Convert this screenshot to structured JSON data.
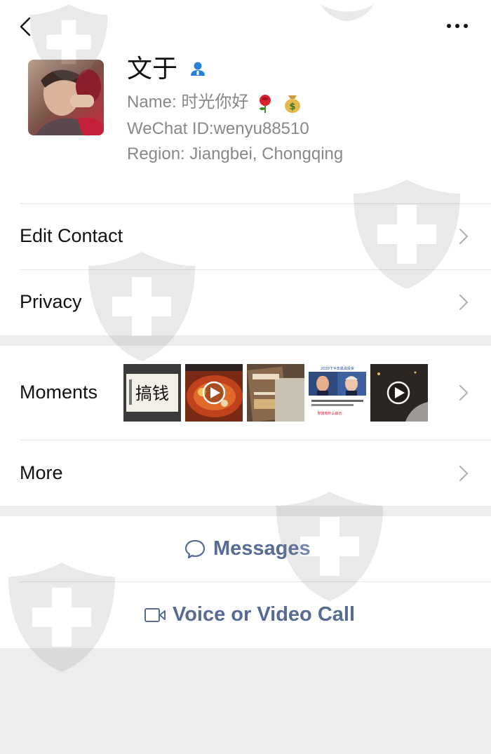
{
  "profile": {
    "nickname": "文于",
    "name_label": "Name: 时光你好",
    "name_emojis": [
      "rose-emoji",
      "money-bag-emoji"
    ],
    "wechat_id": "WeChat ID:wenyu88510",
    "region": "Region: Jiangbei, Chongqing"
  },
  "menu": {
    "edit_contact": "Edit Contact",
    "privacy": "Privacy",
    "moments": "Moments",
    "more": "More"
  },
  "moments": {
    "thumbnails": [
      {
        "icon": "calligraphy-photo",
        "text": "搞钱",
        "is_video": false
      },
      {
        "icon": "hotpot-video",
        "is_video": true
      },
      {
        "icon": "book-photo",
        "is_video": false
      },
      {
        "icon": "news-photo",
        "text": "2020下半年最具投资",
        "text2": "你该有什么启示",
        "is_video": false
      },
      {
        "icon": "night-video",
        "is_video": true
      }
    ]
  },
  "actions": {
    "messages": "Messages",
    "call": "Voice or Video Call"
  },
  "colors": {
    "link": "#576b95",
    "badge": "#1aad19",
    "contact_icon": "#2782d7"
  }
}
